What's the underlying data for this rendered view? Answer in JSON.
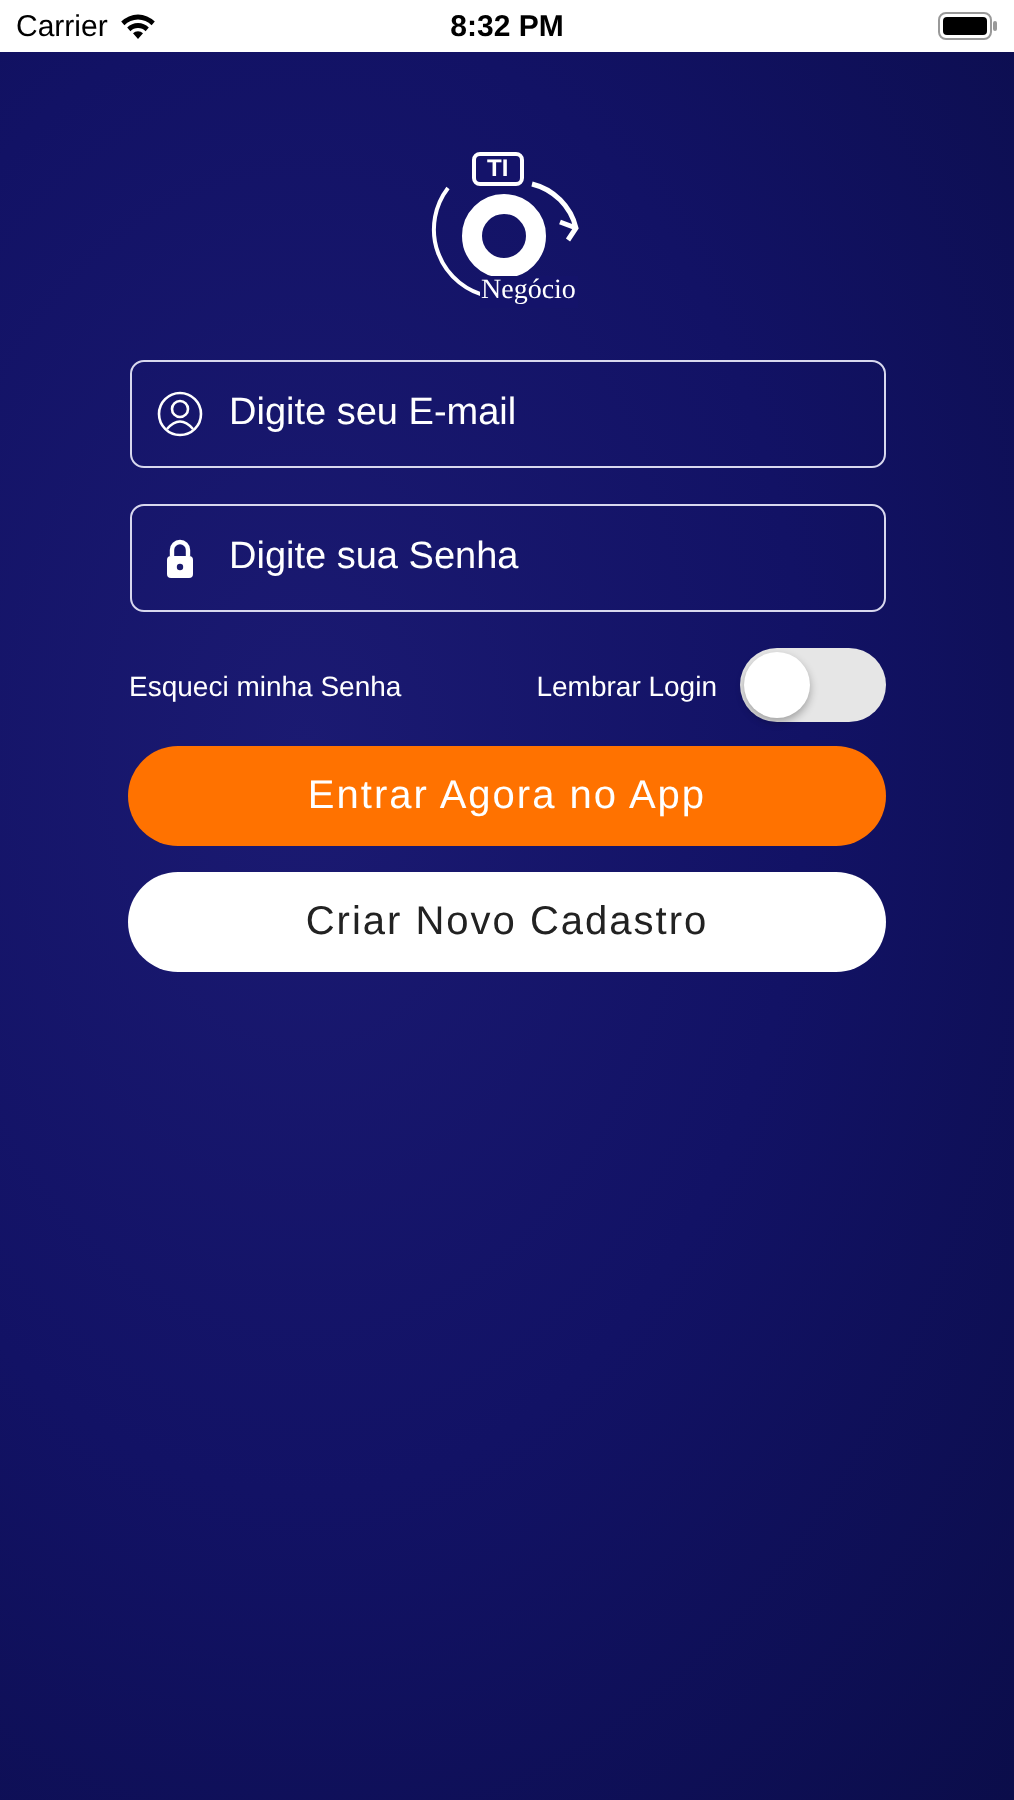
{
  "status_bar": {
    "carrier": "Carrier",
    "time": "8:32 PM"
  },
  "logo": {
    "badge": "TI",
    "name": "Negócio"
  },
  "email_field": {
    "placeholder": "Digite seu E-mail"
  },
  "password_field": {
    "placeholder": "Digite sua Senha"
  },
  "forgot_link": "Esqueci minha Senha",
  "remember": {
    "label": "Lembrar Login",
    "on": false
  },
  "buttons": [
    {
      "label": "Entrar Agora no App",
      "kind": "primary"
    },
    {
      "label": "Criar Novo Cadastro",
      "kind": "secondary"
    }
  ]
}
